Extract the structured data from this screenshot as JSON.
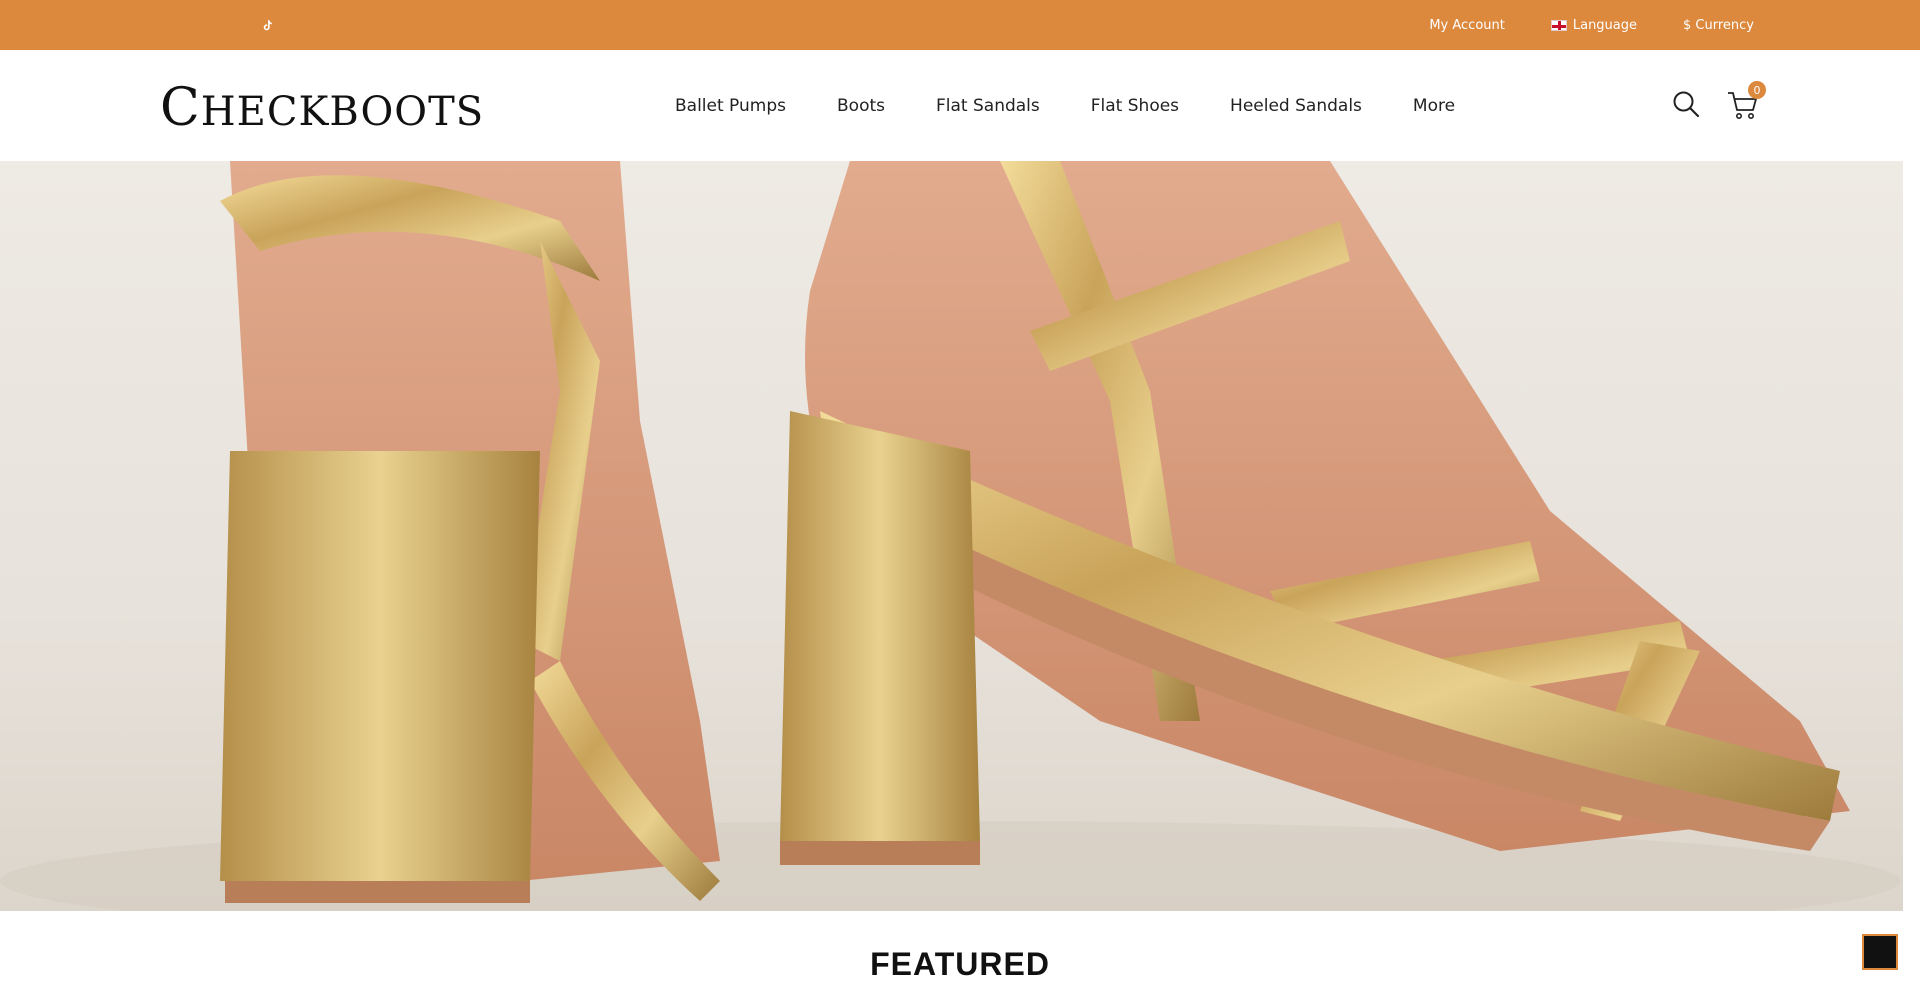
{
  "topbar": {
    "social": [
      {
        "name": "facebook-icon",
        "glyph": ""
      },
      {
        "name": "twitter-icon",
        "glyph": ""
      },
      {
        "name": "tiktok-icon",
        "glyph": ""
      },
      {
        "name": "pinterest-icon",
        "glyph": ""
      },
      {
        "name": "instagram-icon",
        "glyph": ""
      }
    ],
    "account_label": "My Account",
    "language_label": "Language",
    "currency_label": "$ Currency",
    "caret": "",
    "bg_color": "#dc883d"
  },
  "header": {
    "logo_first": "C",
    "logo_rest": "HECKBOOTS",
    "nav": [
      "Ballet Pumps",
      "Boots",
      "Flat Sandals",
      "Flat Shoes",
      "Heeled Sandals",
      "More"
    ],
    "cart_count": "0"
  },
  "main": {
    "featured_title": "FEATURED",
    "back_to_top_glyph": ""
  }
}
